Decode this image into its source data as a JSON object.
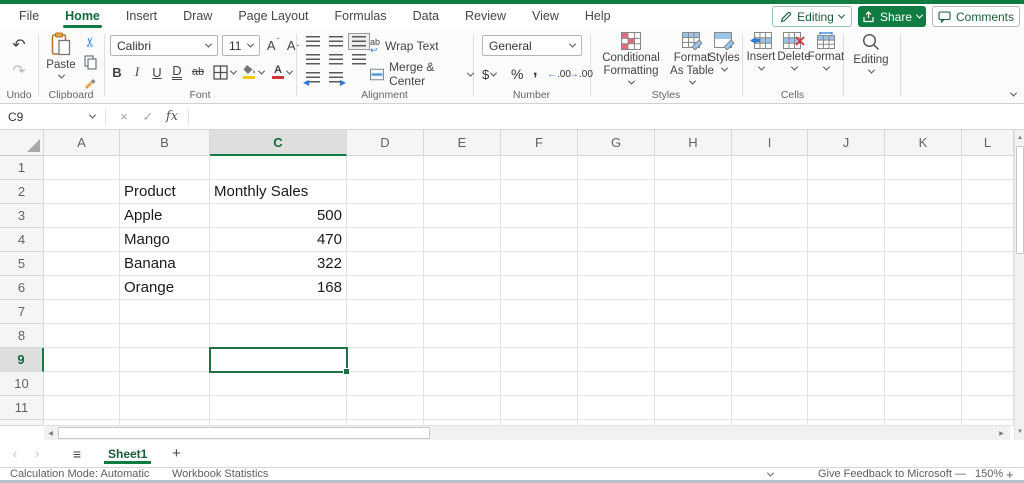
{
  "colors": {
    "excel_green": "#107C41",
    "selection_green": "#1E7145",
    "header_selected_text": "#0E6B39"
  },
  "menu": {
    "tabs": [
      "File",
      "Home",
      "Insert",
      "Draw",
      "Page Layout",
      "Formulas",
      "Data",
      "Review",
      "View",
      "Help"
    ],
    "active_tab": "Home",
    "editing_button": "Editing",
    "share_button": "Share",
    "comments_button": "Comments"
  },
  "ribbon": {
    "undo": {
      "label": "Undo"
    },
    "clipboard": {
      "label": "Clipboard",
      "paste": "Paste"
    },
    "font": {
      "label": "Font",
      "family": "Calibri",
      "size": "11",
      "bold": "B",
      "italic": "I",
      "underline": "U",
      "double_underline": "D",
      "strikethrough": "ab"
    },
    "alignment": {
      "label": "Alignment",
      "wrap_text": "Wrap Text",
      "merge_center": "Merge & Center"
    },
    "number": {
      "label": "Number",
      "format": "General",
      "currency": "$",
      "percent": "%",
      "comma": ",",
      "inc_decimal": "←.00",
      "dec_decimal": "→.00"
    },
    "styles": {
      "label": "Styles",
      "conditional_formatting": "Conditional Formatting",
      "format_as_table": "Format As Table",
      "styles_button": "Styles"
    },
    "cells": {
      "label": "Cells",
      "insert": "Insert",
      "delete": "Delete",
      "format": "Format"
    },
    "editing": {
      "label": "Editing"
    }
  },
  "formula_bar": {
    "name_box": "C9",
    "fx_label": "fx",
    "cancel": "×",
    "enter": "✓",
    "formula_value": ""
  },
  "grid": {
    "column_headers": [
      "A",
      "B",
      "C",
      "D",
      "E",
      "F",
      "G",
      "H",
      "I",
      "J",
      "K",
      "L"
    ],
    "row_headers": [
      "1",
      "2",
      "3",
      "4",
      "5",
      "6",
      "7",
      "8",
      "9",
      "10",
      "11"
    ],
    "selected_cell": "C9",
    "selected_column": "C",
    "selected_row": "9",
    "cells": {
      "B2": "Product",
      "C2": "Monthly Sales",
      "B3": "Apple",
      "C3": "500",
      "B4": "Mango",
      "C4": "470",
      "B5": "Banana",
      "C5": "322",
      "B6": "Orange",
      "C6": "168"
    },
    "right_aligned": [
      "C3",
      "C4",
      "C5",
      "C6"
    ]
  },
  "sheet_tabs": {
    "active": "Sheet1",
    "add_label": "+"
  },
  "status_bar": {
    "calculation_mode": "Calculation Mode: Automatic",
    "workbook_statistics": "Workbook Statistics",
    "feedback": "Give Feedback to Microsoft",
    "zoom_minus": "—",
    "zoom_level": "150%",
    "zoom_plus": "+"
  }
}
